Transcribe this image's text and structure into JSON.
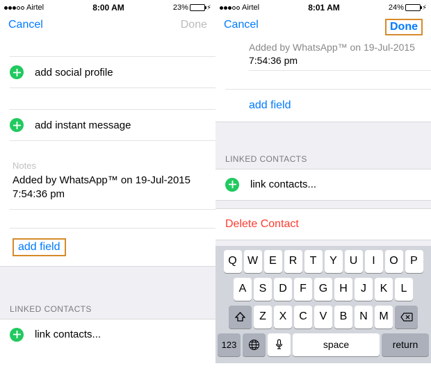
{
  "left": {
    "status": {
      "carrier": "Airtel",
      "time": "8:00 AM",
      "battery_pct": "23%"
    },
    "nav": {
      "cancel": "Cancel",
      "done": "Done"
    },
    "rows": {
      "social": "add social profile",
      "instant": "add instant message",
      "notes_label": "Notes",
      "notes_text": "Added by WhatsApp™ on 19-Jul-2015 7:54:36 pm",
      "add_field": "add field",
      "linked_header": "LINKED CONTACTS",
      "link_contacts": "link contacts..."
    }
  },
  "right": {
    "status": {
      "carrier": "Airtel",
      "time": "8:01 AM",
      "battery_pct": "24%"
    },
    "nav": {
      "cancel": "Cancel",
      "done": "Done"
    },
    "note_line1": "Added by WhatsApp™ on 19-Jul-2015",
    "note_line2": "7:54:36 pm",
    "add_field": "add field",
    "linked_header": "LINKED CONTACTS",
    "link_contacts": "link contacts...",
    "delete": "Delete Contact",
    "keyboard": {
      "row1": [
        "Q",
        "W",
        "E",
        "R",
        "T",
        "Y",
        "U",
        "I",
        "O",
        "P"
      ],
      "row2": [
        "A",
        "S",
        "D",
        "F",
        "G",
        "H",
        "J",
        "K",
        "L"
      ],
      "row3": [
        "Z",
        "X",
        "C",
        "V",
        "B",
        "N",
        "M"
      ],
      "numkey": "123",
      "space": "space",
      "return": "return"
    }
  }
}
